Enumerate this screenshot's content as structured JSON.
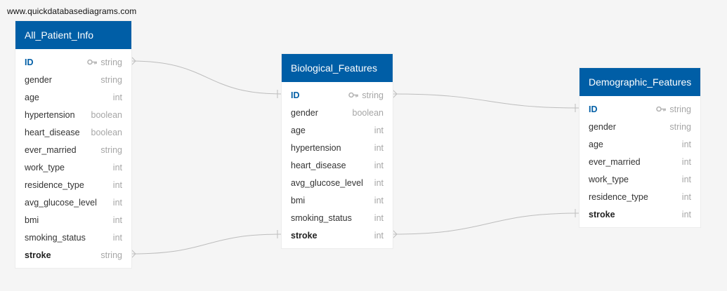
{
  "site_link": "www.quickdatabasediagrams.com",
  "colors": {
    "header": "#005ea6",
    "primary_key": "#005ea6",
    "connector": "#bdbdbd",
    "background": "#f5f5f5"
  },
  "tables": [
    {
      "title": "All_Patient_Info",
      "fields": [
        {
          "name": "ID",
          "type": "string",
          "key": true,
          "bold": false
        },
        {
          "name": "gender",
          "type": "string"
        },
        {
          "name": "age",
          "type": "int"
        },
        {
          "name": "hypertension",
          "type": "boolean"
        },
        {
          "name": "heart_disease",
          "type": "boolean"
        },
        {
          "name": "ever_married",
          "type": "string"
        },
        {
          "name": "work_type",
          "type": "int"
        },
        {
          "name": "residence_type",
          "type": "int"
        },
        {
          "name": "avg_glucose_level",
          "type": "int"
        },
        {
          "name": "bmi",
          "type": "int"
        },
        {
          "name": "smoking_status",
          "type": "int"
        },
        {
          "name": "stroke",
          "type": "string",
          "bold": true
        }
      ]
    },
    {
      "title": "Biological_Features",
      "fields": [
        {
          "name": "ID",
          "type": "string",
          "key": true
        },
        {
          "name": "gender",
          "type": "boolean"
        },
        {
          "name": "age",
          "type": "int"
        },
        {
          "name": "hypertension",
          "type": "int"
        },
        {
          "name": "heart_disease",
          "type": "int"
        },
        {
          "name": "avg_glucose_level",
          "type": "int"
        },
        {
          "name": "bmi",
          "type": "int"
        },
        {
          "name": "smoking_status",
          "type": "int"
        },
        {
          "name": "stroke",
          "type": "int",
          "bold": true
        }
      ]
    },
    {
      "title": "Demographic_Features",
      "fields": [
        {
          "name": "ID",
          "type": "string",
          "key": true
        },
        {
          "name": "gender",
          "type": "string"
        },
        {
          "name": "age",
          "type": "int"
        },
        {
          "name": "ever_married",
          "type": "int"
        },
        {
          "name": "work_type",
          "type": "int"
        },
        {
          "name": "residence_type",
          "type": "int"
        },
        {
          "name": "stroke",
          "type": "int",
          "bold": true
        }
      ]
    }
  ]
}
